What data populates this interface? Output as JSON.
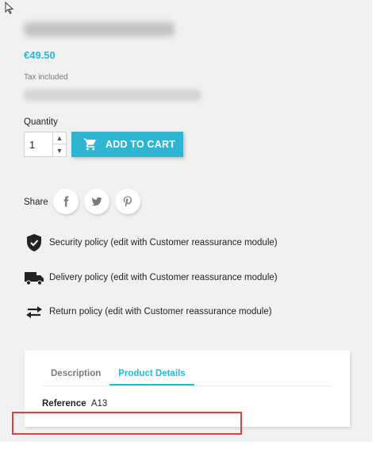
{
  "product": {
    "price": "€49.50",
    "tax_note": "Tax included"
  },
  "quantity": {
    "label": "Quantity",
    "value": "1"
  },
  "cart": {
    "button_label": "ADD TO CART",
    "accent_color": "#2fb5d2"
  },
  "share": {
    "label": "Share",
    "networks": [
      "facebook-icon",
      "twitter-icon",
      "pinterest-icon"
    ]
  },
  "reassurance": [
    {
      "icon": "shield-icon",
      "text": "Security policy (edit with Customer reassurance module)"
    },
    {
      "icon": "truck-icon",
      "text": "Delivery policy (edit with Customer reassurance module)"
    },
    {
      "icon": "exchange-arrows-icon",
      "text": "Return policy (edit with Customer reassurance module)"
    }
  ],
  "tabs": [
    {
      "label": "Description",
      "active": false
    },
    {
      "label": "Product Details",
      "active": true
    }
  ],
  "details": {
    "reference_label": "Reference",
    "reference_value": "A13"
  },
  "colors": {
    "price": "#24b9d7",
    "highlight_box": "#e33f3f"
  }
}
